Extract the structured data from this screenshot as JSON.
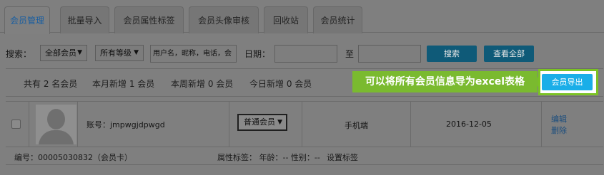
{
  "tabs": [
    {
      "label": "会员管理",
      "active": true
    },
    {
      "label": "批量导入",
      "active": false
    },
    {
      "label": "会员属性标签",
      "active": false
    },
    {
      "label": "会员头像审核",
      "active": false
    },
    {
      "label": "回收站",
      "active": false
    },
    {
      "label": "会员统计",
      "active": false
    }
  ],
  "search": {
    "label": "搜索：",
    "member_type": "全部会员",
    "level": "所有等级",
    "keyword_placeholder": "用户名，昵称，电话，会",
    "date_label": "日期：",
    "date_to": "至",
    "search_button": "搜索",
    "view_all_button": "查看全部"
  },
  "stats": {
    "total": "共有 2 名会员",
    "month": "本月新增 1 会员",
    "week": "本周新增 0 会员",
    "today": "今日新增 0 会员"
  },
  "callout": "可以将所有会员信息导为excel表格",
  "export_button": "会员导出",
  "member": {
    "account": "账号：jmpwgjdpwgd",
    "level": "普通会员",
    "source": "手机端",
    "date": "2016-12-05",
    "edit": "编辑",
    "delete": "删除",
    "number": "编号：00005030832（会员卡）",
    "attributes": "属性标签：  年龄：--    性别：--",
    "set_tag": "设置标签"
  },
  "colors": {
    "overlay": "#7f7f7f",
    "accent_blue": "#1aaee8",
    "callout_green": "#7aba2f"
  }
}
